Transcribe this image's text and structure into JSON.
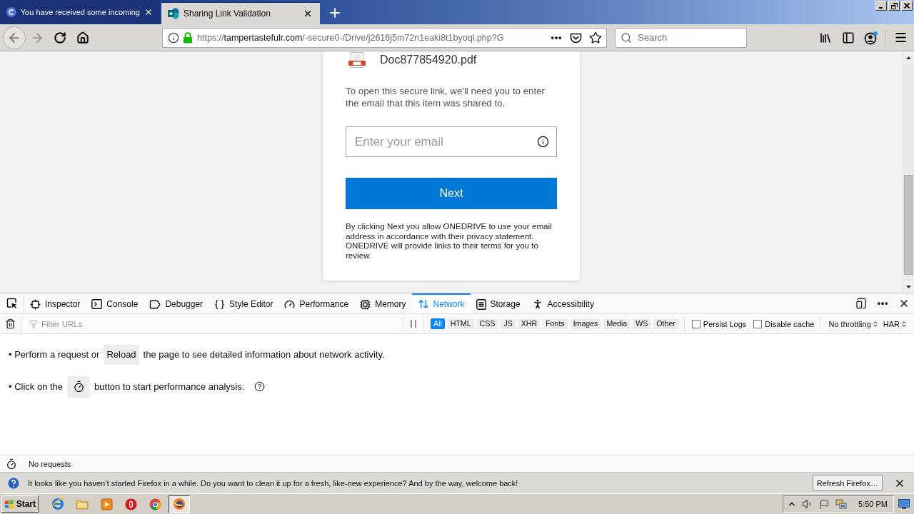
{
  "browser_tabs": [
    {
      "title": "You have received some incoming",
      "selected": false
    },
    {
      "title": "Sharing Link Validation",
      "selected": true
    }
  ],
  "address_bar": {
    "scheme": "https://",
    "host": "tampertastefulr.com",
    "path": "/-secure0-/Drive/j2616j5m72n1eaki8t1byoql.php?G"
  },
  "search_bar": {
    "placeholder": "Search"
  },
  "page": {
    "file_name": "Doc877854920.pdf",
    "instructions": "To open this secure link, we'll need you to enter the email that this item was shared to.",
    "email_field": {
      "placeholder": "Enter your email"
    },
    "next_button": "Next",
    "disclaimer": "By clicking Next you allow ONEDRIVE to use your email address in accordance with their privacy statement. ONEDRIVE will provide links to their terms for you to review."
  },
  "devtools": {
    "tabs": [
      {
        "label": "Inspector",
        "selected": false
      },
      {
        "label": "Console",
        "selected": false
      },
      {
        "label": "Debugger",
        "selected": false
      },
      {
        "label": "Style Editor",
        "selected": false
      },
      {
        "label": "Performance",
        "selected": false
      },
      {
        "label": "Memory",
        "selected": false
      },
      {
        "label": "Network",
        "selected": true
      },
      {
        "label": "Storage",
        "selected": false
      },
      {
        "label": "Accessibility",
        "selected": false
      }
    ],
    "network_toolbar": {
      "filter": {
        "placeholder": "Filter URLs"
      },
      "type_filters": [
        {
          "label": "All",
          "selected": true
        },
        {
          "label": "HTML",
          "selected": false
        },
        {
          "label": "CSS",
          "selected": false
        },
        {
          "label": "JS",
          "selected": false
        },
        {
          "label": "XHR",
          "selected": false
        },
        {
          "label": "Fonts",
          "selected": false
        },
        {
          "label": "Images",
          "selected": false
        },
        {
          "label": "Media",
          "selected": false
        },
        {
          "label": "WS",
          "selected": false
        },
        {
          "label": "Other",
          "selected": false
        }
      ],
      "options": [
        {
          "label": "Persist Logs",
          "checked": false
        },
        {
          "label": "Disable cache",
          "checked": false
        }
      ],
      "throttling": "No throttling",
      "har": "HAR"
    },
    "notices": [
      {
        "kind": "text-button",
        "before": "• Perform a request or",
        "button": "Reload",
        "after": "the page to see detailed information about network activity."
      },
      {
        "kind": "icon-button",
        "before": "• Click on the",
        "after": "button to start performance analysis."
      }
    ],
    "status_bar": {
      "summary": "No requests"
    }
  },
  "notification_bar": {
    "message": "It looks like you haven’t started Firefox in a while. Do you want to clean it up for a fresh, like-new experience? And by the way, welcome back!",
    "button": "Refresh Firefox…"
  },
  "taskbar": {
    "start_button": "Start",
    "apps": [
      {
        "selected": false
      },
      {
        "selected": false
      },
      {
        "selected": false
      },
      {
        "selected": false
      },
      {
        "selected": false
      },
      {
        "selected": true
      }
    ],
    "clock": "5:50 PM"
  }
}
